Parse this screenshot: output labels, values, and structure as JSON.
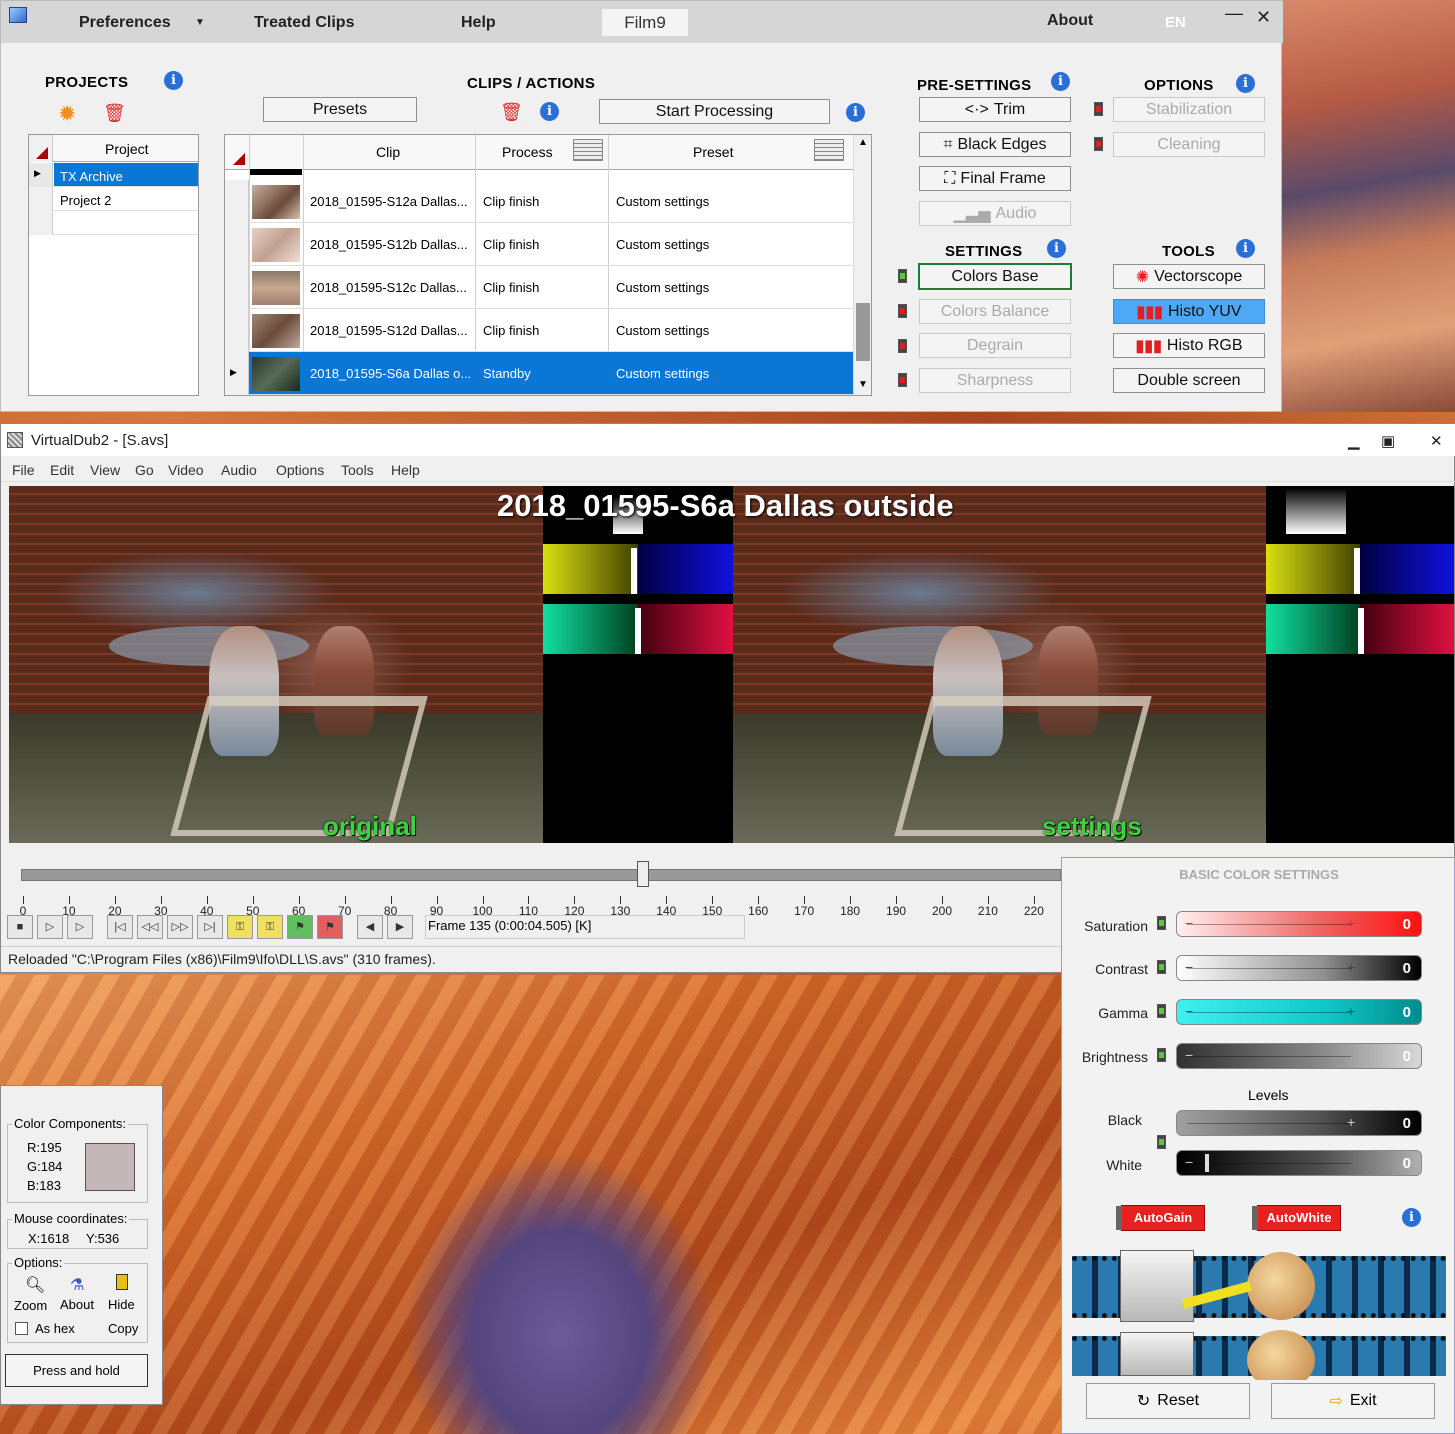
{
  "film9": {
    "menu": {
      "preferences": "Preferences",
      "treated_clips": "Treated Clips",
      "help": "Help",
      "app_tab": "Film9",
      "about": "About",
      "lang": "EN",
      "min": "—",
      "close": "✕"
    },
    "projects": {
      "title": "PROJECTS",
      "column": "Project",
      "rows": [
        {
          "name": "TX Archive",
          "selected": true
        },
        {
          "name": "Project 2",
          "selected": false
        }
      ]
    },
    "clips": {
      "title": "CLIPS / ACTIONS",
      "presets_button": "Presets",
      "start_button": "Start Processing",
      "columns": {
        "clip": "Clip",
        "process": "Process",
        "preset": "Preset"
      },
      "rows": [
        {
          "clip": "2018_01595-S12a  Dallas...",
          "process": "Clip finish",
          "preset": "Custom settings",
          "selected": false
        },
        {
          "clip": "2018_01595-S12b  Dallas...",
          "process": "Clip finish",
          "preset": "Custom settings",
          "selected": false
        },
        {
          "clip": "2018_01595-S12c  Dallas...",
          "process": "Clip finish",
          "preset": "Custom settings",
          "selected": false
        },
        {
          "clip": "2018_01595-S12d  Dallas...",
          "process": "Clip finish",
          "preset": "Custom settings",
          "selected": false
        },
        {
          "clip": "2018_01595-S6a Dallas o...",
          "process": "Standby",
          "preset": "Custom settings",
          "selected": true
        }
      ]
    },
    "presettings": {
      "title": "PRE-SETTINGS",
      "trim": "Trim",
      "black_edges": "Black Edges",
      "final_frame": "Final Frame",
      "audio": "Audio"
    },
    "options": {
      "title": "OPTIONS",
      "stabilization": "Stabilization",
      "cleaning": "Cleaning"
    },
    "settings": {
      "title": "SETTINGS",
      "colors_base": "Colors Base",
      "colors_balance": "Colors Balance",
      "degrain": "Degrain",
      "sharpness": "Sharpness"
    },
    "tools": {
      "title": "TOOLS",
      "vectorscope": "Vectorscope",
      "histo_yuv": "Histo YUV",
      "histo_rgb": "Histo RGB",
      "double_screen": "Double screen"
    }
  },
  "vdub": {
    "title": "VirtualDub2  - [S.avs]",
    "menu": [
      "File",
      "Edit",
      "View",
      "Go",
      "Video",
      "Audio",
      "Options",
      "Tools",
      "Help"
    ],
    "video_title": "2018_01595-S6a Dallas outside",
    "label_left": "original",
    "label_right": "settings",
    "timeline_ticks": [
      "0",
      "10",
      "20",
      "30",
      "40",
      "50",
      "60",
      "70",
      "80",
      "90",
      "100",
      "110",
      "120",
      "130",
      "140",
      "150",
      "160",
      "170",
      "180",
      "190",
      "200",
      "210",
      "220"
    ],
    "current_frame": 135,
    "total_frames": 310,
    "frame_readout": "Frame 135 (0:00:04.505) [K]",
    "status": "Reloaded \"C:\\Program Files (x86)\\Film9\\Ifo\\DLL\\S.avs\" (310 frames)."
  },
  "picker": {
    "components_title": "Color Components:",
    "r": "R:195",
    "g": "G:184",
    "b": "B:183",
    "swatch_color": "#c3b8b7",
    "mouse_title": "Mouse coordinates:",
    "mx": "X:1618",
    "my": "Y:536",
    "options_title": "Options:",
    "zoom": "Zoom",
    "about": "About",
    "hide": "Hide",
    "as_hex": "As hex",
    "copy": "Copy",
    "press_hold": "Press and hold"
  },
  "basic": {
    "title": "BASIC COLOR SETTINGS",
    "saturation": {
      "label": "Saturation",
      "value": "0"
    },
    "contrast": {
      "label": "Contrast",
      "value": "0"
    },
    "gamma": {
      "label": "Gamma",
      "value": "0"
    },
    "brightness": {
      "label": "Brightness",
      "value": "0"
    },
    "levels": "Levels",
    "black": {
      "label": "Black",
      "value": "0"
    },
    "white": {
      "label": "White",
      "value": "0"
    },
    "autogain": "AutoGain",
    "autowhite": "AutoWhite",
    "reset": "Reset",
    "exit": "Exit"
  }
}
